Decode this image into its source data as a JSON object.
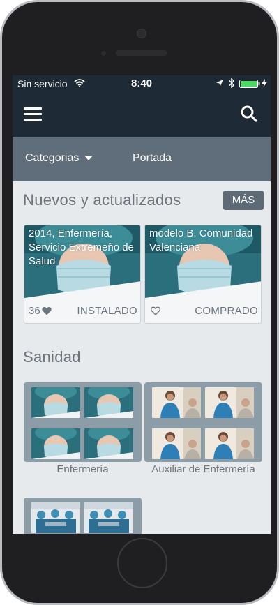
{
  "status_bar": {
    "carrier": "Sin servicio",
    "time": "8:40"
  },
  "tabs": {
    "categories_label": "Categorias",
    "home_label": "Portada"
  },
  "new_section": {
    "title": "Nuevos y actualizados",
    "more_label": "MÁS",
    "cards": [
      {
        "title": "2014, Enfermería, Servicio Extremeño de Salud",
        "likes": "36",
        "status": "INSTALADO"
      },
      {
        "title": "modelo B, Comunidad Valenciana",
        "status": "COMPRADO"
      }
    ]
  },
  "health_section": {
    "title": "Sanidad",
    "categories": [
      {
        "label": "Enfermería"
      },
      {
        "label": "Auxiliar de Enfermería"
      },
      {
        "label": ""
      }
    ]
  },
  "colors": {
    "nav_bg": "#1f2a37",
    "tab_bg": "#606e7b",
    "screen_bg": "#e7eaed",
    "more_button_bg": "#5e6b77",
    "text_muted": "#6c747c",
    "battery_green": "#4cd964"
  },
  "icons": {
    "menu": "hamburger-menu-icon",
    "search": "magnifier-search-icon",
    "wifi": "wifi-icon",
    "location": "location-arrow-icon",
    "bluetooth": "bluetooth-icon",
    "battery": "battery-icon",
    "like": "heart-icon"
  }
}
